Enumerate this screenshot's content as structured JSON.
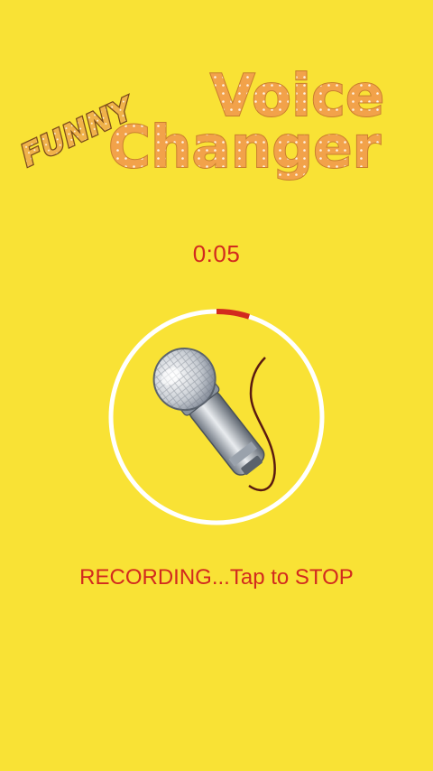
{
  "app": {
    "logo": {
      "line1": "FUNNY",
      "line2": "Voice",
      "line3": "Changer"
    }
  },
  "recorder": {
    "elapsed": "0:05",
    "status_text": "RECORDING...Tap to STOP",
    "progress_fraction": 0.05,
    "icon": "microphone-icon"
  },
  "colors": {
    "background": "#F9E235",
    "accent_text": "#D22A1E",
    "ring": "#FFFFFF",
    "progress": "#D22A1E",
    "logo_fill": "#F2A24A"
  }
}
